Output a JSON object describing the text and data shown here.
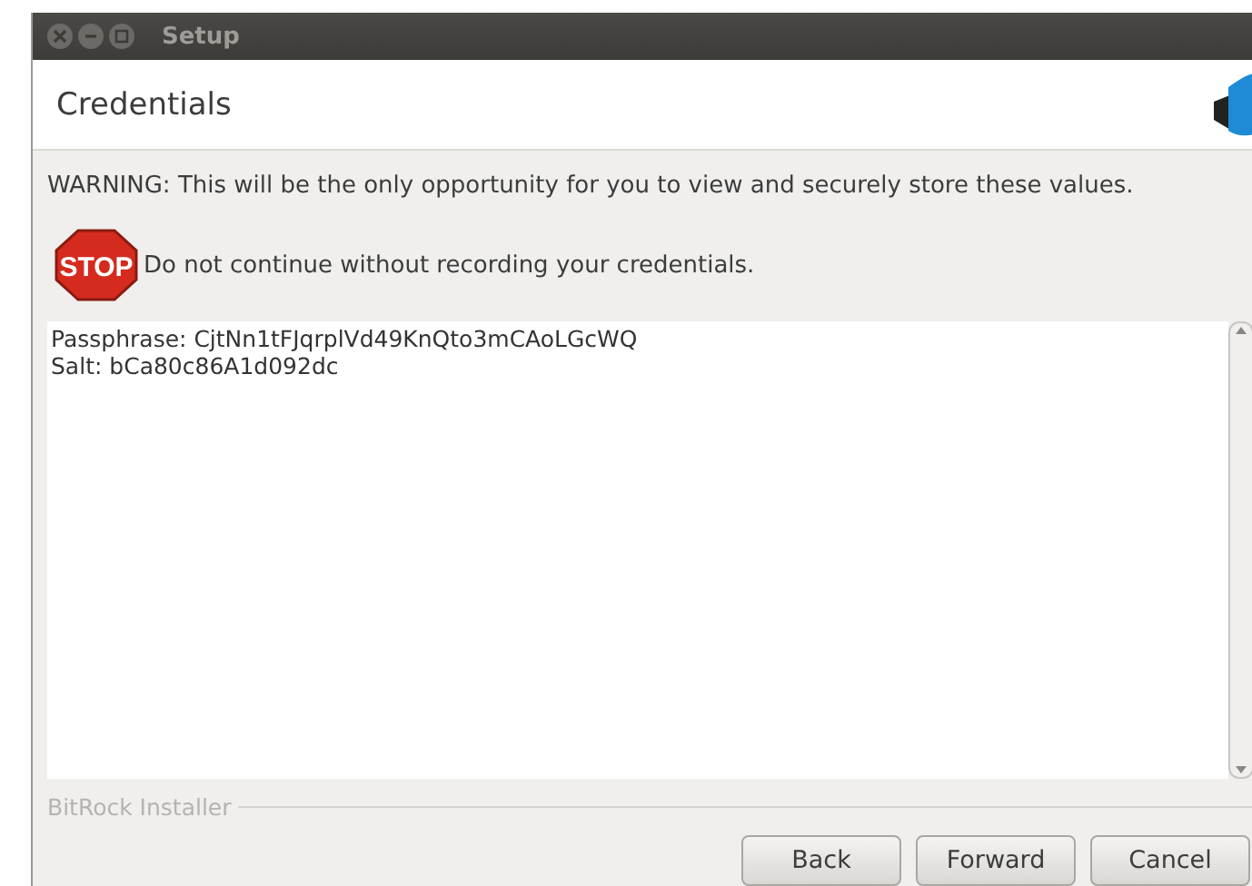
{
  "window": {
    "title": "Setup"
  },
  "header": {
    "title": "Credentials"
  },
  "warning": "WARNING: This will be the only opportunity for you to view and securely store these values.",
  "notice": "Do not continue without recording your credentials.",
  "stop_sign": "STOP",
  "credentials": [
    "Passphrase: CjtNn1tFJqrplVd49KnQto3mCAoLGcWQ",
    "Salt: bCa80c86A1d092dc"
  ],
  "footer": {
    "label": "BitRock Installer"
  },
  "buttons": [
    "Back",
    "Forward",
    "Cancel"
  ]
}
